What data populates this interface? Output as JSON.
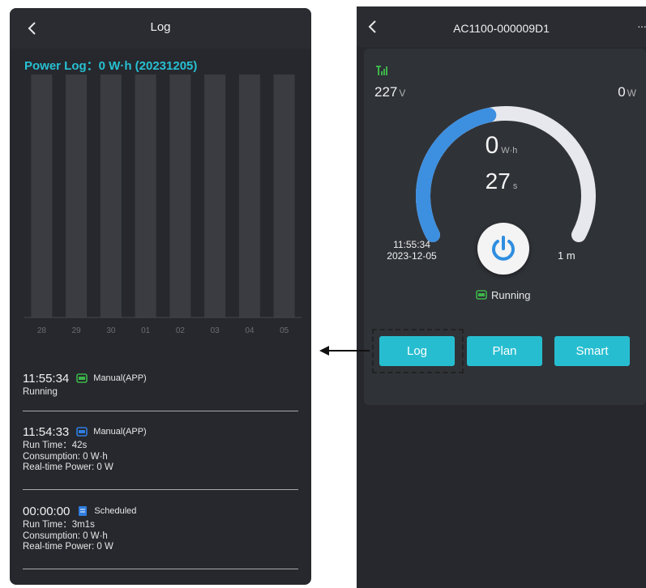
{
  "log_screen": {
    "title": "Log",
    "chart_title": "Power Log：0 W·h (20231205)",
    "entries": [
      {
        "time": "11:55:34",
        "source": "Manual(APP)",
        "lines": [
          "Running"
        ]
      },
      {
        "time": "11:54:33",
        "source": "Manual(APP)",
        "lines": [
          "Run Time：42s",
          "Consumption: 0 W·h",
          "Real-time Power: 0 W"
        ]
      },
      {
        "time": "00:00:00",
        "source": "Scheduled",
        "lines": [
          "Run Time：3m1s",
          "Consumption: 0 W·h",
          "Real-time Power: 0 W"
        ]
      }
    ]
  },
  "chart_data": {
    "type": "bar",
    "categories": [
      "28",
      "29",
      "30",
      "01",
      "02",
      "03",
      "04",
      "05"
    ],
    "values": [
      0,
      0,
      0,
      0,
      0,
      0,
      0,
      0
    ],
    "title": "Power Log：0 W·h (20231205)",
    "bar_color": "#3a3c41",
    "grid": false
  },
  "device_screen": {
    "title": "AC1100-000009D1",
    "more": "···",
    "voltage_value": "227",
    "voltage_unit": "V",
    "power_value": "0",
    "power_unit": "W",
    "energy_value": "0",
    "energy_unit": "W·h",
    "seconds_value": "27",
    "seconds_unit": "s",
    "start_time": "11:55:34",
    "start_date": "2023-12-05",
    "duration": "1 m",
    "status": "Running",
    "gauge_progress": 0.45,
    "buttons": {
      "log": "Log",
      "plan": "Plan",
      "smart": "Smart"
    }
  },
  "colors": {
    "accent": "#27bdd0",
    "chart_title": "#27c0d2",
    "gauge_active": "#3d8fe0",
    "gauge_track": "#e6e8ee",
    "status_green": "#3db54a",
    "schedule_blue": "#2f7de0"
  }
}
